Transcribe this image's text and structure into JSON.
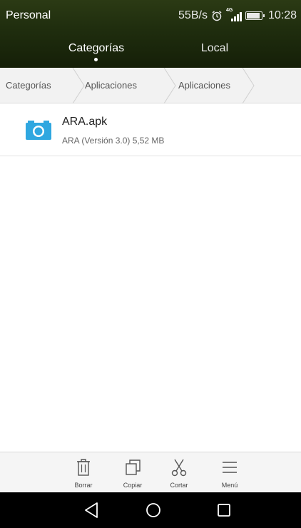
{
  "status_bar": {
    "carrier": "Personal",
    "speed": "55B/s",
    "network": "4G",
    "time": "10:28",
    "icons": [
      "alarm-icon",
      "signal-icon",
      "battery-icon"
    ]
  },
  "tabs": [
    {
      "label": "Categorías",
      "selected": true
    },
    {
      "label": "Local",
      "selected": false
    }
  ],
  "breadcrumb": [
    "Categorías",
    "Aplicaciones",
    "Aplicaciones"
  ],
  "files": [
    {
      "name": "ARA.apk",
      "meta": "ARA (Versión 3.0) 5,52 MB",
      "icon": "camera-icon",
      "icon_color": "#2fa7e0"
    }
  ],
  "toolbar": {
    "delete_label": "Borrar",
    "copy_label": "Copiar",
    "cut_label": "Cortar",
    "menu_label": "Menú"
  },
  "colors": {
    "header_bg": "#1f2d0e",
    "accent_icon": "#2fa7e0"
  }
}
